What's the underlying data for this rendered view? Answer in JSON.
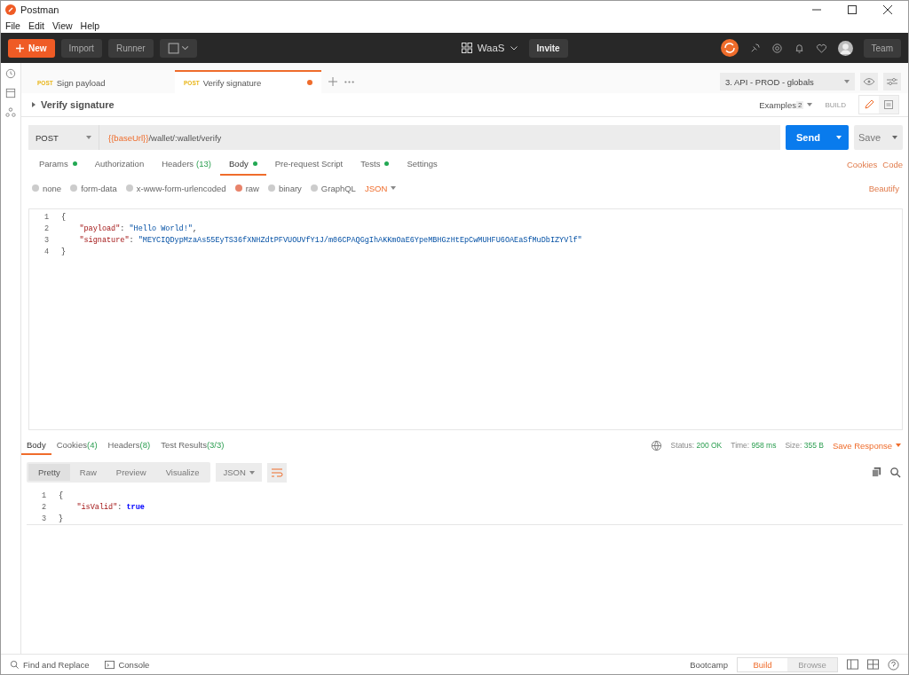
{
  "window": {
    "title": "Postman"
  },
  "menu": [
    "File",
    "Edit",
    "View",
    "Help"
  ],
  "toolbar": {
    "new_label": "New",
    "import_label": "Import",
    "runner_label": "Runner",
    "workspace": "WaaS",
    "invite_label": "Invite",
    "team_label": "Team"
  },
  "request_tabs": [
    {
      "method": "POST",
      "name": "Sign payload",
      "selected": false,
      "unsaved": false
    },
    {
      "method": "POST",
      "name": "Verify signature",
      "selected": true,
      "unsaved": true
    }
  ],
  "environment": "3. API - PROD - globals",
  "request": {
    "title": "Verify signature",
    "examples_label": "Examples",
    "examples_count": "2",
    "build_label": "BUILD",
    "method": "POST",
    "url_variable": "{{baseUrl}}",
    "url_path": "/wallet/:wallet/verify",
    "send_label": "Send",
    "save_label": "Save"
  },
  "request_sections": [
    {
      "label": "Params",
      "indicator": true,
      "selected": false
    },
    {
      "label": "Authorization",
      "indicator": false,
      "selected": false
    },
    {
      "label": "Headers",
      "count": "(13)",
      "indicator": false,
      "selected": false
    },
    {
      "label": "Body",
      "indicator": true,
      "selected": true
    },
    {
      "label": "Pre-request Script",
      "indicator": false,
      "selected": false
    },
    {
      "label": "Tests",
      "indicator": true,
      "selected": false
    },
    {
      "label": "Settings",
      "indicator": false,
      "selected": false
    }
  ],
  "request_links": [
    "Cookies",
    "Code"
  ],
  "body_types": [
    {
      "label": "none",
      "selected": false
    },
    {
      "label": "form-data",
      "selected": false
    },
    {
      "label": "x-www-form-urlencoded",
      "selected": false
    },
    {
      "label": "raw",
      "selected": true
    },
    {
      "label": "binary",
      "selected": false
    },
    {
      "label": "GraphQL",
      "selected": false
    }
  ],
  "body_format": "JSON",
  "beautify_label": "Beautify",
  "request_body": [
    {
      "number": "1",
      "tokens": [
        {
          "kind": "punct",
          "text": "{"
        }
      ]
    },
    {
      "number": "2",
      "tokens": [
        {
          "kind": "key",
          "text": "    \"payload\""
        },
        {
          "kind": "punct",
          "text": ": "
        },
        {
          "kind": "string",
          "text": "\"Hello World!\""
        },
        {
          "kind": "punct",
          "text": ","
        }
      ]
    },
    {
      "number": "3",
      "tokens": [
        {
          "kind": "key",
          "text": "    \"signature\""
        },
        {
          "kind": "punct",
          "text": ": "
        },
        {
          "kind": "string",
          "text": "\"MEYCIQDypMzaAs55EyTS36fXNHZdtPFVUOUVfY1J/m06CPAQGgIhAKKmOaE6YpeMBHGzHtEpCwMUHFU6OAEaSfMuDbIZYVlf\""
        }
      ]
    },
    {
      "number": "4",
      "tokens": [
        {
          "kind": "punct",
          "text": "}"
        }
      ]
    }
  ],
  "response_sections": [
    {
      "label": "Body",
      "selected": true
    },
    {
      "label": "Cookies",
      "count": "(4)",
      "selected": false
    },
    {
      "label": "Headers",
      "count": "(8)",
      "selected": false
    },
    {
      "label": "Test Results",
      "count": "(3/3)",
      "selected": false
    }
  ],
  "response_stats": [
    {
      "label": "Status:",
      "value": "200 OK"
    },
    {
      "label": "Time:",
      "value": "958 ms"
    },
    {
      "label": "Size:",
      "value": "355 B"
    }
  ],
  "save_response_label": "Save Response",
  "response_views": [
    {
      "label": "Pretty",
      "selected": true
    },
    {
      "label": "Raw",
      "selected": false
    },
    {
      "label": "Preview",
      "selected": false
    },
    {
      "label": "Visualize",
      "selected": false
    }
  ],
  "response_format": "JSON",
  "response_body": [
    {
      "number": "1",
      "tokens": [
        {
          "kind": "punct",
          "text": "{"
        }
      ]
    },
    {
      "number": "2",
      "tokens": [
        {
          "kind": "key",
          "text": "    \"isValid\""
        },
        {
          "kind": "punct",
          "text": ": "
        },
        {
          "kind": "bool",
          "text": "true"
        }
      ]
    },
    {
      "number": "3",
      "tokens": [
        {
          "kind": "punct",
          "text": "}"
        }
      ]
    }
  ],
  "status_bar": {
    "find_label": "Find and Replace",
    "console_label": "Console",
    "bootcamp_label": "Bootcamp",
    "modes": [
      {
        "label": "Build",
        "selected": true
      },
      {
        "label": "Browse",
        "selected": false
      }
    ]
  }
}
